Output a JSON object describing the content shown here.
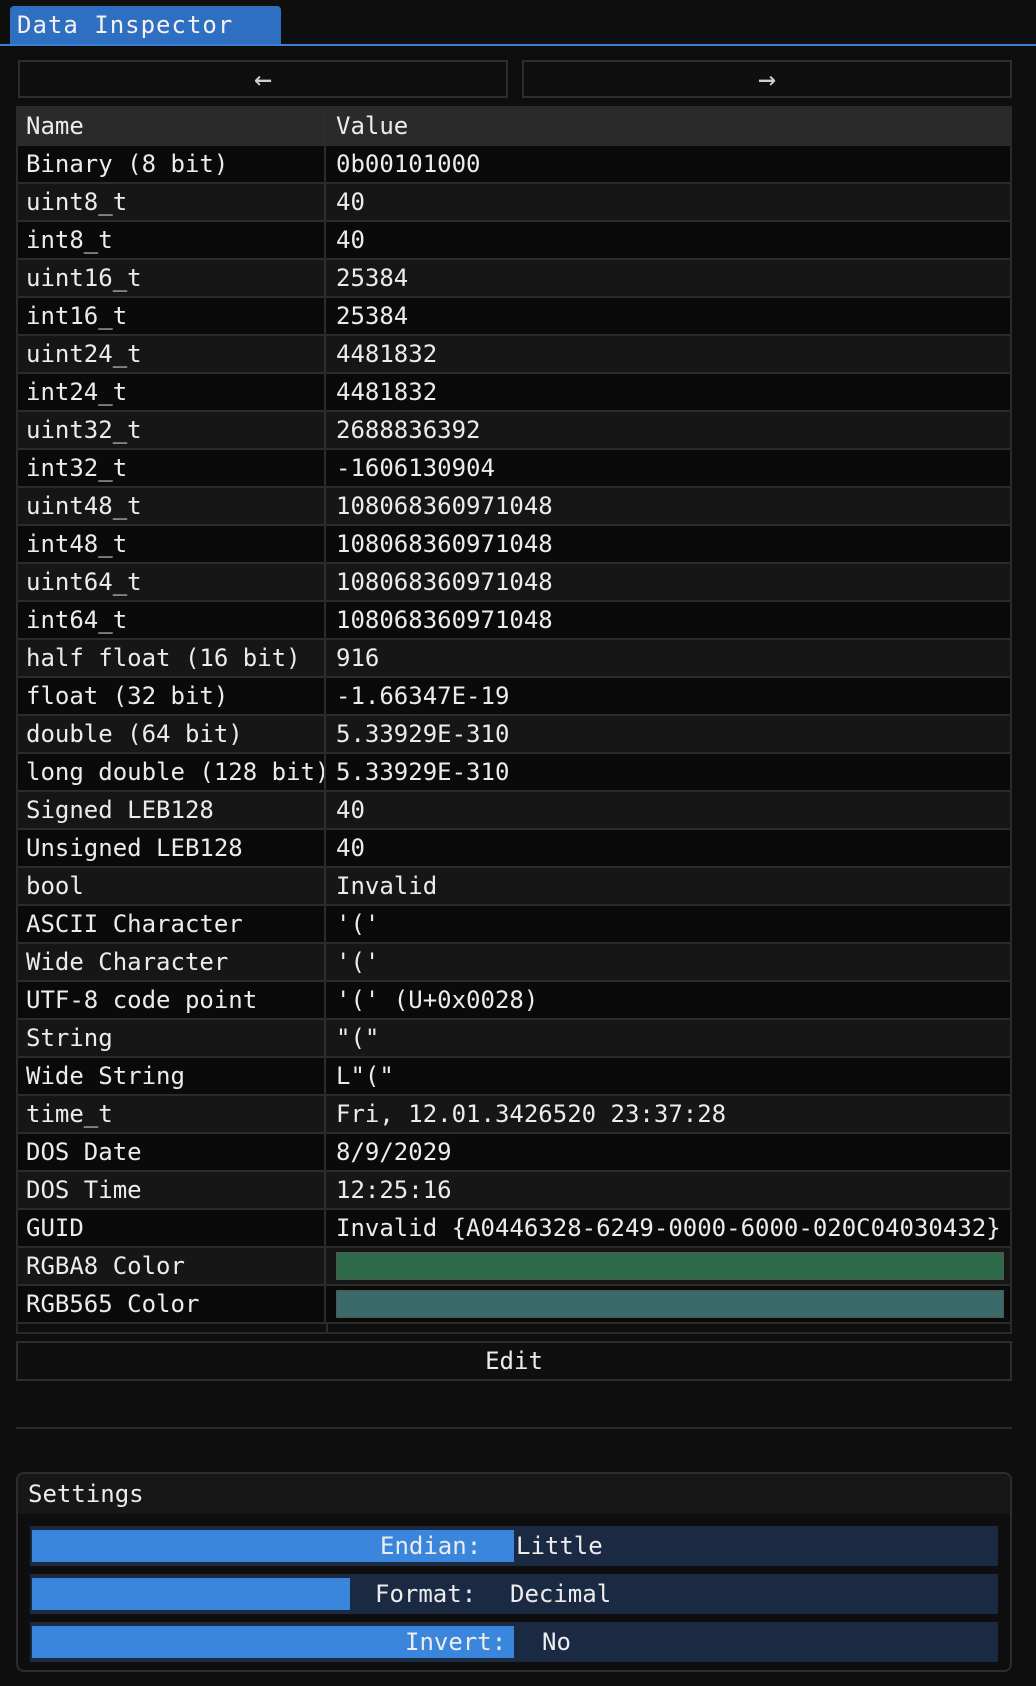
{
  "window": {
    "tab_title": "Data Inspector"
  },
  "nav": {
    "prev_icon": "←",
    "next_icon": "→"
  },
  "table": {
    "headers": {
      "name": "Name",
      "value": "Value"
    },
    "rows": [
      {
        "name": "Binary (8 bit)",
        "value": "0b00101000"
      },
      {
        "name": "uint8_t",
        "value": "40"
      },
      {
        "name": "int8_t",
        "value": "40"
      },
      {
        "name": "uint16_t",
        "value": "25384"
      },
      {
        "name": "int16_t",
        "value": "25384"
      },
      {
        "name": "uint24_t",
        "value": "4481832"
      },
      {
        "name": "int24_t",
        "value": "4481832"
      },
      {
        "name": "uint32_t",
        "value": "2688836392"
      },
      {
        "name": "int32_t",
        "value": "-1606130904"
      },
      {
        "name": "uint48_t",
        "value": "108068360971048"
      },
      {
        "name": "int48_t",
        "value": "108068360971048"
      },
      {
        "name": "uint64_t",
        "value": "108068360971048"
      },
      {
        "name": "int64_t",
        "value": "108068360971048"
      },
      {
        "name": "half float (16 bit)",
        "value": "916"
      },
      {
        "name": "float (32 bit)",
        "value": "-1.66347E-19"
      },
      {
        "name": "double (64 bit)",
        "value": "5.33929E-310"
      },
      {
        "name": "long double (128 bit)",
        "value": "5.33929E-310"
      },
      {
        "name": "Signed LEB128",
        "value": "40"
      },
      {
        "name": "Unsigned LEB128",
        "value": "40"
      },
      {
        "name": "bool",
        "value": "Invalid"
      },
      {
        "name": "ASCII Character",
        "value": "'('"
      },
      {
        "name": "Wide Character",
        "value": "'('"
      },
      {
        "name": "UTF-8 code point",
        "value": "'(' (U+0x0028)"
      },
      {
        "name": "String",
        "value": "\"(\""
      },
      {
        "name": "Wide String",
        "value": "L\"(\""
      },
      {
        "name": "time_t",
        "value": "Fri, 12.01.3426520 23:37:28"
      },
      {
        "name": "DOS Date",
        "value": "8/9/2029"
      },
      {
        "name": "DOS Time",
        "value": "12:25:16"
      },
      {
        "name": "GUID",
        "value": "Invalid {A0446328-6249-0000-6000-020C04030432}"
      },
      {
        "name": "RGBA8 Color",
        "color": "#2d6a4a"
      },
      {
        "name": "RGB565 Color",
        "color": "#3a6b6a"
      }
    ]
  },
  "edit_label": "Edit",
  "settings": {
    "title": "Settings",
    "endian": {
      "label": "Endian:",
      "value": "Little",
      "fill_fraction": 0.5
    },
    "format": {
      "label": "Format:",
      "value": "Decimal",
      "fill_fraction": 0.33
    },
    "invert": {
      "label": "Invert:",
      "value": "No",
      "fill_fraction": 0.5
    }
  },
  "colors": {
    "accent": "#3b86dd",
    "tab": "#2f6fc1",
    "combo_bg": "#1b2a43"
  }
}
